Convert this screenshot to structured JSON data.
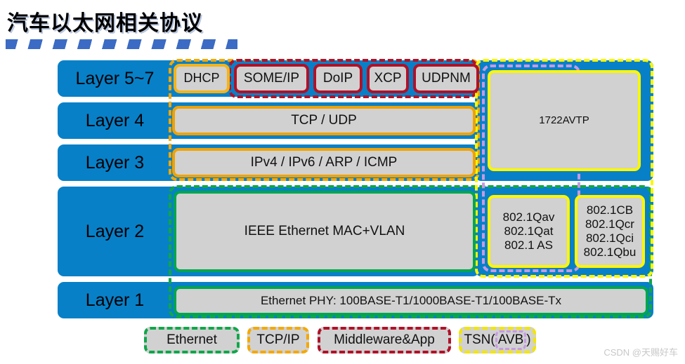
{
  "page": {
    "title": "汽车以太网相关协议",
    "watermark": "CSDN @天赐好车"
  },
  "colors": {
    "layer_bar_blue": "#0780c8",
    "chip_gray": "#d1d1d1",
    "ethernet_green": "#10a64a",
    "tcpip_orange": "#f5a800",
    "middleware_red": "#b01128",
    "tsn_yellow": "#fdf600",
    "avb_purple": "#c79ae0",
    "title_stripe_blue": "#3b6bc4"
  },
  "diagram": {
    "layers": [
      {
        "label": "Layer 5~7"
      },
      {
        "label": "Layer 4"
      },
      {
        "label": "Layer 3"
      },
      {
        "label": "Layer 2"
      },
      {
        "label": "Layer 1"
      }
    ],
    "protocols": {
      "dhcp": "DHCP",
      "someip": "SOME/IP",
      "doip": "DoIP",
      "xcp": "XCP",
      "udpnm": "UDPNM",
      "avtp": "1722AVTP",
      "tcp_udp": "TCP / UDP",
      "ip_stack": "IPv4 / IPv6 / ARP / ICMP",
      "mac_vlan": "IEEE Ethernet MAC+VLAN",
      "tsn_avb_std": "802.1Qav\n802.1Qat\n802.1 AS",
      "tsn_std": "802.1CB\n802.1Qcr\n802.1Qci\n802.1Qbu",
      "phy": "Ethernet PHY: 100BASE-T1/1000BASE-T1/100BASE-Tx"
    }
  },
  "legend": {
    "ethernet": "Ethernet",
    "tcpip": "TCP/IP",
    "middleware": "Middleware&App",
    "tsn_prefix": "TSN(",
    "tsn_avb": "AVB",
    "tsn_suffix": ")"
  }
}
